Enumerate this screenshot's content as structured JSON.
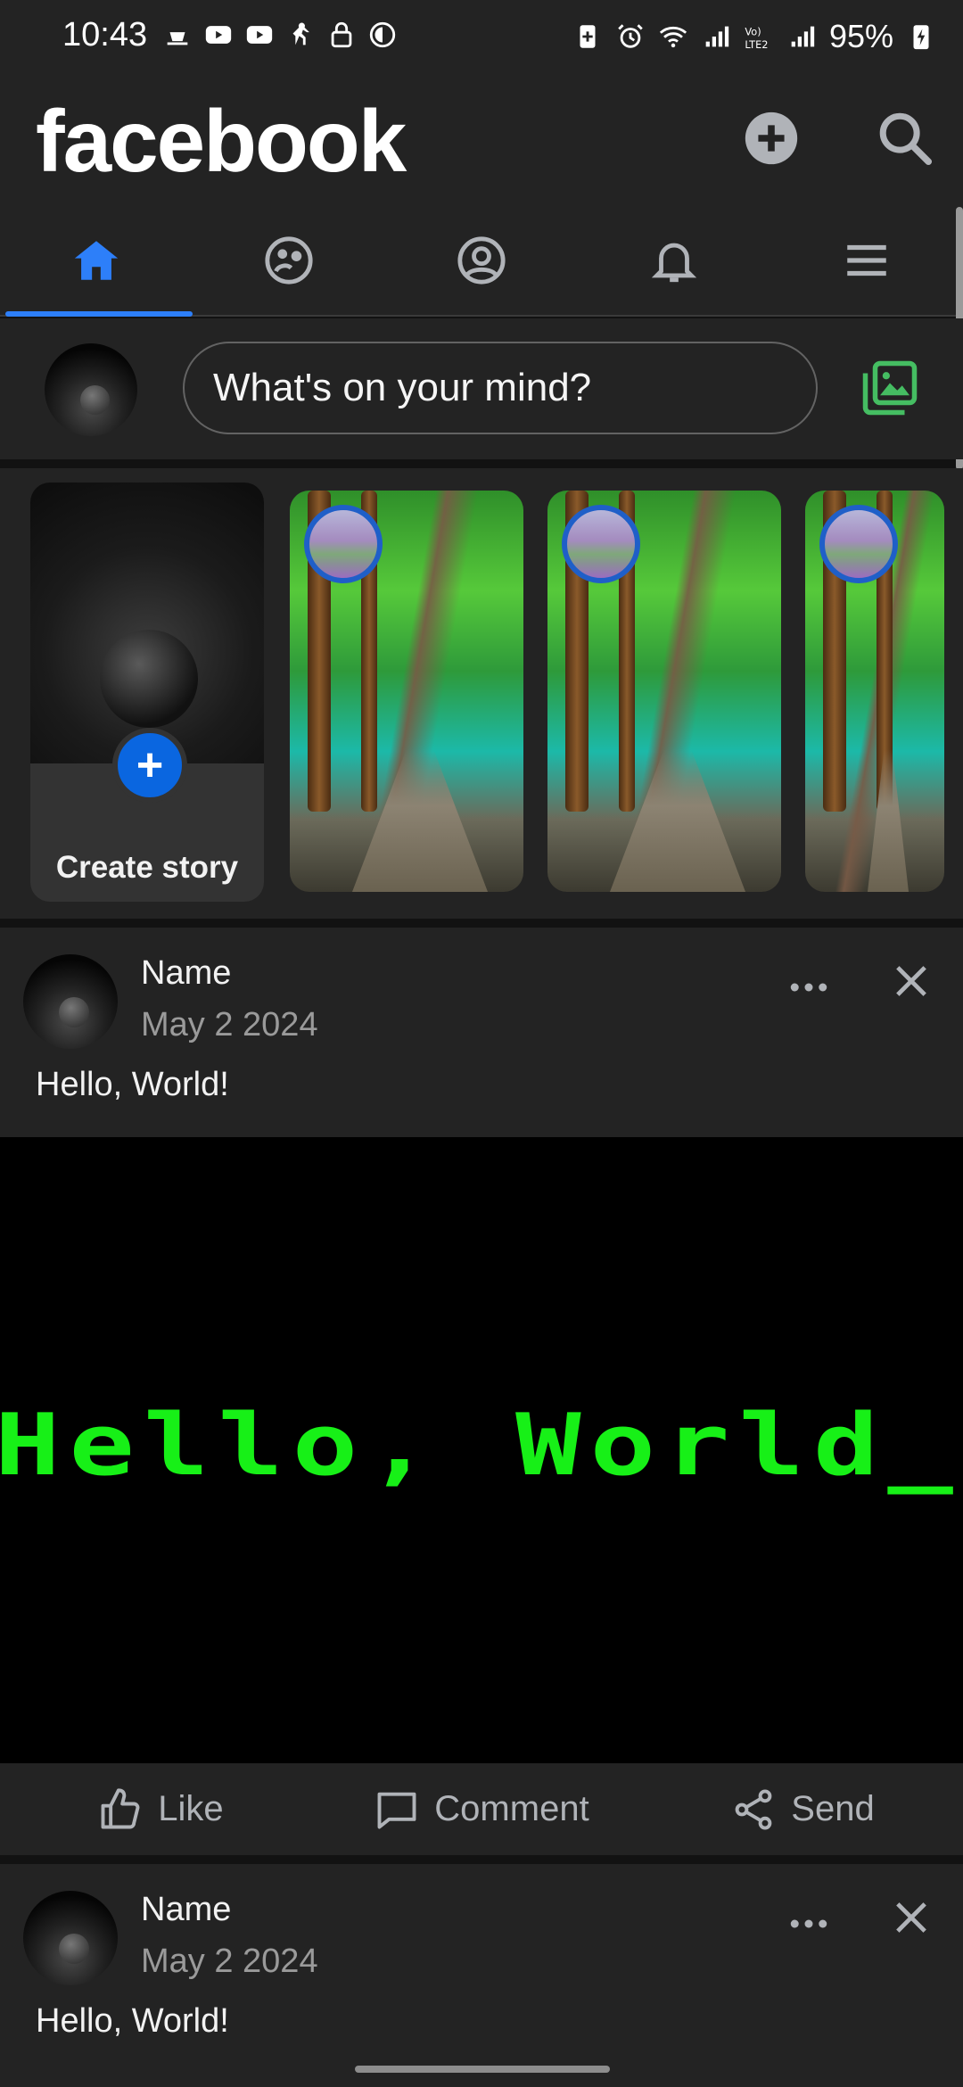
{
  "status_bar": {
    "time": "10:43",
    "battery": "95%"
  },
  "header": {
    "logo": "facebook"
  },
  "tabs": [
    {
      "name": "home",
      "active": true
    },
    {
      "name": "groups",
      "active": false
    },
    {
      "name": "profile",
      "active": false
    },
    {
      "name": "notifications",
      "active": false
    },
    {
      "name": "menu",
      "active": false
    }
  ],
  "composer": {
    "placeholder": "What's on your mind?"
  },
  "stories": {
    "create_label": "Create story"
  },
  "posts": [
    {
      "name": "Name",
      "date": "May 2 2024",
      "text": "Hello, World!",
      "image_text": "Hello, World_"
    },
    {
      "name": "Name",
      "date": "May 2 2024",
      "text": "Hello, World!"
    }
  ],
  "actions": {
    "like": "Like",
    "comment": "Comment",
    "send": "Send"
  },
  "colors": {
    "accent": "#2d7ff9",
    "background": "#232323",
    "terminal_green": "#17f017",
    "photo_green": "#45bd62"
  }
}
